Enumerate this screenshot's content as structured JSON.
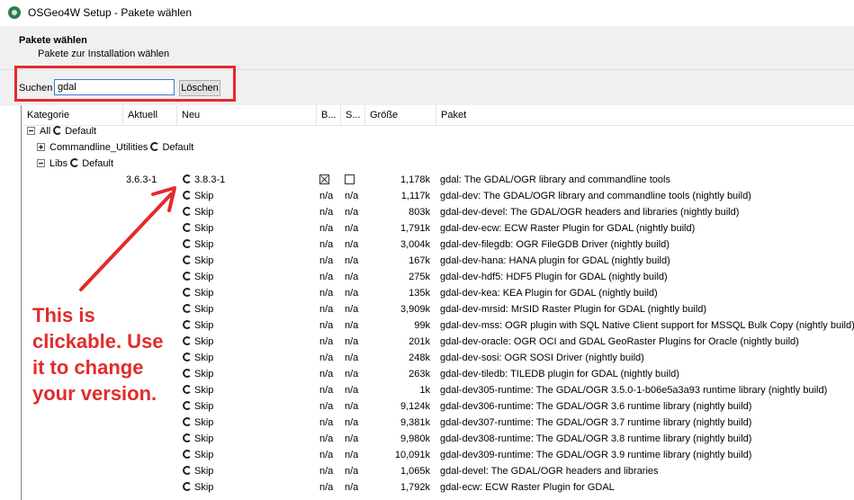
{
  "window": {
    "title": "OSGeo4W Setup - Pakete wählen"
  },
  "header": {
    "title": "Pakete wählen",
    "subtitle": "Pakete zur Installation wählen"
  },
  "search": {
    "label": "Suchen",
    "value": "gdal",
    "clear_label": "Löschen"
  },
  "columns": [
    "Kategorie",
    "Aktuell",
    "Neu",
    "B...",
    "S...",
    "Größe",
    "Paket"
  ],
  "tree": {
    "all": "All",
    "all_mode": "Default",
    "commandline": "Commandline_Utilities",
    "commandline_mode": "Default",
    "libs": "Libs",
    "libs_mode": "Default"
  },
  "packages": [
    {
      "current": "3.6.3-1",
      "new": "3.8.3-1",
      "b": "checked",
      "s": "unchecked",
      "size": "1,178k",
      "name": "gdal: The GDAL/OGR library and commandline tools"
    },
    {
      "current": "",
      "new": "Skip",
      "b": "n/a",
      "s": "n/a",
      "size": "1,117k",
      "name": "gdal-dev: The GDAL/OGR library and commandline tools (nightly build)"
    },
    {
      "current": "",
      "new": "Skip",
      "b": "n/a",
      "s": "n/a",
      "size": "803k",
      "name": "gdal-dev-devel: The GDAL/OGR headers and libraries (nightly build)"
    },
    {
      "current": "",
      "new": "Skip",
      "b": "n/a",
      "s": "n/a",
      "size": "1,791k",
      "name": "gdal-dev-ecw: ECW Raster Plugin for GDAL (nightly build)"
    },
    {
      "current": "",
      "new": "Skip",
      "b": "n/a",
      "s": "n/a",
      "size": "3,004k",
      "name": "gdal-dev-filegdb: OGR FileGDB Driver (nightly build)"
    },
    {
      "current": "",
      "new": "Skip",
      "b": "n/a",
      "s": "n/a",
      "size": "167k",
      "name": "gdal-dev-hana: HANA plugin for GDAL (nightly build)"
    },
    {
      "current": "",
      "new": "Skip",
      "b": "n/a",
      "s": "n/a",
      "size": "275k",
      "name": "gdal-dev-hdf5: HDF5 Plugin for GDAL (nightly build)"
    },
    {
      "current": "",
      "new": "Skip",
      "b": "n/a",
      "s": "n/a",
      "size": "135k",
      "name": "gdal-dev-kea: KEA Plugin for GDAL (nightly build)"
    },
    {
      "current": "",
      "new": "Skip",
      "b": "n/a",
      "s": "n/a",
      "size": "3,909k",
      "name": "gdal-dev-mrsid: MrSID Raster Plugin for GDAL (nightly build)"
    },
    {
      "current": "",
      "new": "Skip",
      "b": "n/a",
      "s": "n/a",
      "size": "99k",
      "name": "gdal-dev-mss: OGR plugin with SQL Native Client support for MSSQL Bulk Copy (nightly build)"
    },
    {
      "current": "",
      "new": "Skip",
      "b": "n/a",
      "s": "n/a",
      "size": "201k",
      "name": "gdal-dev-oracle: OGR OCI and GDAL GeoRaster Plugins for Oracle (nightly build)"
    },
    {
      "current": "",
      "new": "Skip",
      "b": "n/a",
      "s": "n/a",
      "size": "248k",
      "name": "gdal-dev-sosi: OGR SOSI Driver (nightly build)"
    },
    {
      "current": "",
      "new": "Skip",
      "b": "n/a",
      "s": "n/a",
      "size": "263k",
      "name": "gdal-dev-tiledb: TILEDB plugin for GDAL (nightly build)"
    },
    {
      "current": "",
      "new": "Skip",
      "b": "n/a",
      "s": "n/a",
      "size": "1k",
      "name": "gdal-dev305-runtime: The GDAL/OGR 3.5.0-1-b06e5a3a93 runtime library (nightly build)"
    },
    {
      "current": "",
      "new": "Skip",
      "b": "n/a",
      "s": "n/a",
      "size": "9,124k",
      "name": "gdal-dev306-runtime: The GDAL/OGR 3.6 runtime library (nightly build)"
    },
    {
      "current": "",
      "new": "Skip",
      "b": "n/a",
      "s": "n/a",
      "size": "9,381k",
      "name": "gdal-dev307-runtime: The GDAL/OGR 3.7 runtime library (nightly build)"
    },
    {
      "current": "",
      "new": "Skip",
      "b": "n/a",
      "s": "n/a",
      "size": "9,980k",
      "name": "gdal-dev308-runtime: The GDAL/OGR 3.8 runtime library (nightly build)"
    },
    {
      "current": "",
      "new": "Skip",
      "b": "n/a",
      "s": "n/a",
      "size": "10,091k",
      "name": "gdal-dev309-runtime: The GDAL/OGR 3.9 runtime library (nightly build)"
    },
    {
      "current": "",
      "new": "Skip",
      "b": "n/a",
      "s": "n/a",
      "size": "1,065k",
      "name": "gdal-devel: The GDAL/OGR headers and libraries"
    },
    {
      "current": "",
      "new": "Skip",
      "b": "n/a",
      "s": "n/a",
      "size": "1,792k",
      "name": "gdal-ecw: ECW Raster Plugin for GDAL"
    }
  ],
  "annotation": {
    "text": "This is\nclickable. Use\nit to change\nyour version.",
    "color": "#e32b2b"
  }
}
